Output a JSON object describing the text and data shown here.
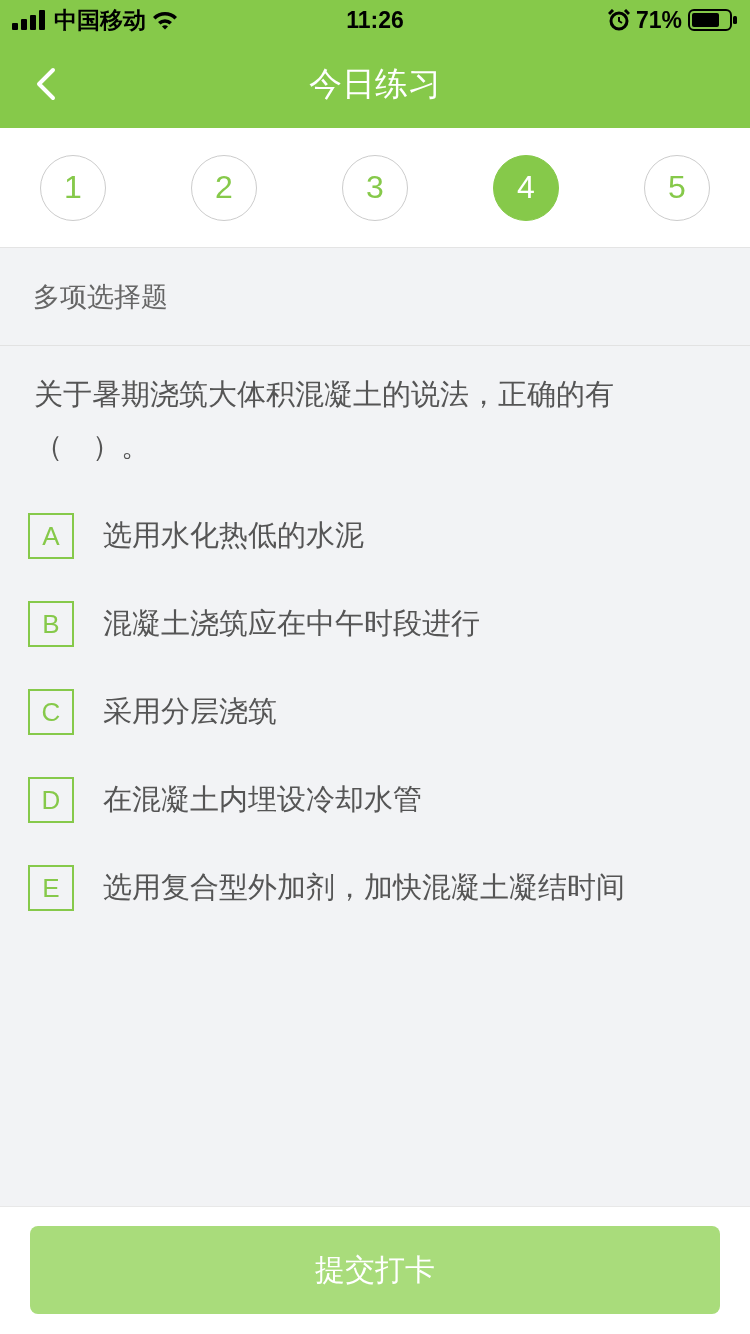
{
  "status_bar": {
    "carrier": "中国移动",
    "time": "11:26",
    "battery": "71%"
  },
  "nav": {
    "title": "今日练习"
  },
  "question_tabs": [
    {
      "label": "1",
      "selected": false
    },
    {
      "label": "2",
      "selected": false
    },
    {
      "label": "3",
      "selected": false
    },
    {
      "label": "4",
      "selected": true
    },
    {
      "label": "5",
      "selected": false
    }
  ],
  "section": "多项选择题",
  "question": "关于暑期浇筑大体积混凝土的说法，正确的有（　）。",
  "options": [
    {
      "letter": "A",
      "text": "选用水化热低的水泥",
      "selected": false
    },
    {
      "letter": "B",
      "text": "混凝土浇筑应在中午时段进行",
      "selected": false
    },
    {
      "letter": "C",
      "text": "采用分层浇筑",
      "selected": false
    },
    {
      "letter": "D",
      "text": "在混凝土内埋设冷却水管",
      "selected": false
    },
    {
      "letter": "E",
      "text": "选用复合型外加剂，加快混凝土凝结时间",
      "selected": false
    }
  ],
  "submit": {
    "label": "提交打卡",
    "disabled": true
  }
}
